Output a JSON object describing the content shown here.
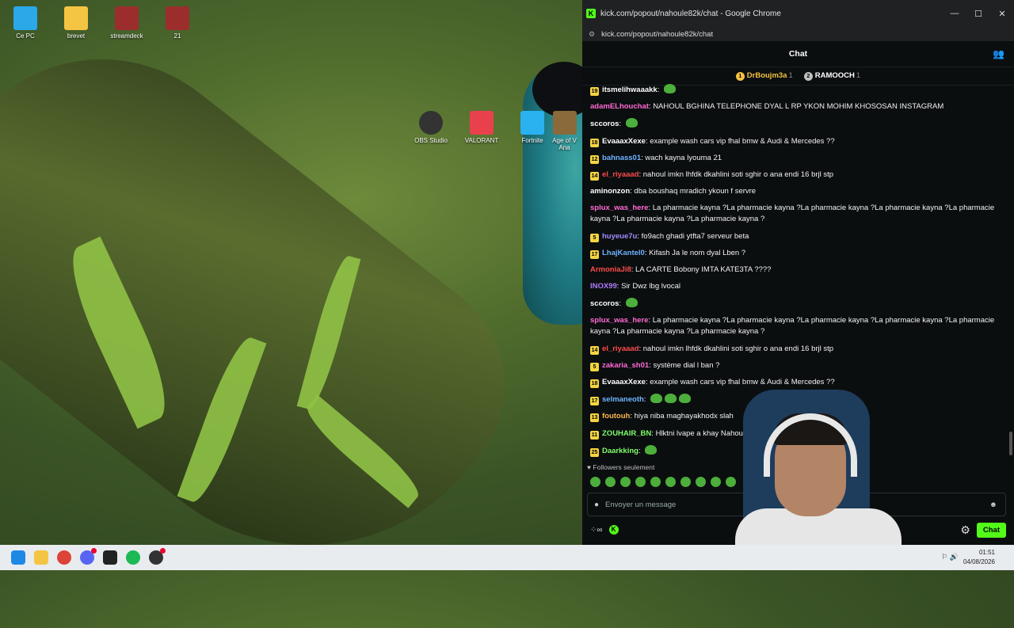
{
  "desktop": {
    "icons": [
      {
        "label": "Ce PC",
        "color": "#2aa8e8"
      },
      {
        "label": "brevet",
        "color": "#f4c542"
      },
      {
        "label": "streamdeck",
        "color": "#9b2d2d"
      },
      {
        "label": "21",
        "color": "#9b2d2d"
      }
    ],
    "mid_icons": [
      {
        "label": "OBS Studio",
        "color": "#333"
      },
      {
        "label": "VALORANT",
        "color": "#e8414d"
      },
      {
        "label": "Fortnite",
        "color": "#2ab2f0"
      },
      {
        "label": "Age of V Ana",
        "color": "#8a6a3a"
      }
    ]
  },
  "window": {
    "title": "kick.com/popout/nahoule82k/chat - Google Chrome",
    "url": "kick.com/popout/nahoule82k/chat",
    "controls": {
      "minimize": "—",
      "maximize": "☐",
      "close": "✕"
    }
  },
  "chat": {
    "header": "Chat",
    "leaders": [
      {
        "rank": "1",
        "name": "DrBoujm3a",
        "count": "1",
        "color": "#f5c341",
        "name_color": "#f5c341"
      },
      {
        "rank": "2",
        "name": "RAMOOCH",
        "count": "1",
        "color": "#c0c0c0",
        "name_color": "#ffffff"
      }
    ],
    "messages": [
      {
        "badge": "19",
        "user": "itsmelihwaaakk",
        "color": "#ffffff",
        "text": "",
        "emotes": 1
      },
      {
        "badge": "",
        "user": "adamELhouchat",
        "color": "#ff6ad5",
        "text": "NAHOUL BGHINA TELEPHONE DYAL L RP YKON MOHIM KHOSOSAN INSTAGRAM",
        "emotes": 0
      },
      {
        "badge": "",
        "user": "sccoros",
        "color": "#ffffff",
        "text": "",
        "emotes": 1
      },
      {
        "badge": "18",
        "user": "EvaaaxXexe",
        "color": "#ffffff",
        "text": "example wash cars vip fhal bmw & Audi & Mercedes ??",
        "emotes": 0
      },
      {
        "badge": "12",
        "user": "bahnass01",
        "color": "#6fb4ff",
        "text": "wach kayna lyouma 21",
        "emotes": 0
      },
      {
        "badge": "14",
        "user": "el_riyaaad",
        "color": "#ff4b4b",
        "text": "nahoul imkn lhfdk dkahlini soti sghir o ana endi 16 brjl stp",
        "emotes": 0
      },
      {
        "badge": "",
        "user": "aminonzon",
        "color": "#ffffff",
        "text": "dba boushaq mradich ykoun f servre",
        "emotes": 0
      },
      {
        "badge": "",
        "user": "splux_was_here",
        "color": "#ff6ad5",
        "text": "La pharmacie kayna ?La pharmacie kayna ?La pharmacie kayna ?La pharmacie kayna ?La pharmacie kayna ?La pharmacie kayna ?La pharmacie kayna ?",
        "emotes": 0
      },
      {
        "badge": "5",
        "user": "huyeue7u",
        "color": "#a08cff",
        "text": "fo9ach ghadi ytfta7 serveur beta",
        "emotes": 0
      },
      {
        "badge": "17",
        "user": "LhajKantel0",
        "color": "#6fb4ff",
        "text": "Kifash Ja le nom dyal Lben ?",
        "emotes": 0
      },
      {
        "badge": "",
        "user": "ArmoniaJi8",
        "color": "#ff4b4b",
        "text": "LA CARTE Bobony IMTA KATE3TA ????",
        "emotes": 0
      },
      {
        "badge": "",
        "user": "INOX99",
        "color": "#b07bff",
        "text": "Sir Dwz lbg lvocal",
        "emotes": 0
      },
      {
        "badge": "",
        "user": "sccoros",
        "color": "#ffffff",
        "text": "",
        "emotes": 1
      },
      {
        "badge": "",
        "user": "splux_was_here",
        "color": "#ff6ad5",
        "text": "La pharmacie kayna ?La pharmacie kayna ?La pharmacie kayna ?La pharmacie kayna ?La pharmacie kayna ?La pharmacie kayna ?La pharmacie kayna ?",
        "emotes": 0
      },
      {
        "badge": "14",
        "user": "el_riyaaad",
        "color": "#ff4b4b",
        "text": "nahoul imkn lhfdk dkahlini soti sghir o ana endi 16 brjl stp",
        "emotes": 0
      },
      {
        "badge": "5",
        "user": "zakaria_sh01",
        "color": "#ff6ad5",
        "text": "système dial l ban ?",
        "emotes": 0
      },
      {
        "badge": "18",
        "user": "EvaaaxXexe",
        "color": "#ffffff",
        "text": "example wash cars vip fhal bmw & Audi & Mercedes ??",
        "emotes": 0
      },
      {
        "badge": "17",
        "user": "selmaneoth",
        "color": "#6fb4ff",
        "text": "",
        "emotes": 3
      },
      {
        "badge": "13",
        "user": "foutouh",
        "color": "#ffb74d",
        "text": "hiya niba maghayakhodx slah",
        "emotes": 0
      },
      {
        "badge": "11",
        "user": "ZOUHAIR_BN",
        "color": "#7fff6a",
        "text": "Hlktni lvape a khay Nahoule chi bac",
        "emotes": 0
      },
      {
        "badge": "25",
        "user": "Daarkking",
        "color": "#7fff6a",
        "text": "",
        "emotes": 1
      }
    ],
    "followers_label": "Followers seulement",
    "input_placeholder": "Envoyer un message",
    "chat_button": "Chat"
  },
  "taskbar": {
    "time": "01:51",
    "date": "04/08/2026"
  }
}
